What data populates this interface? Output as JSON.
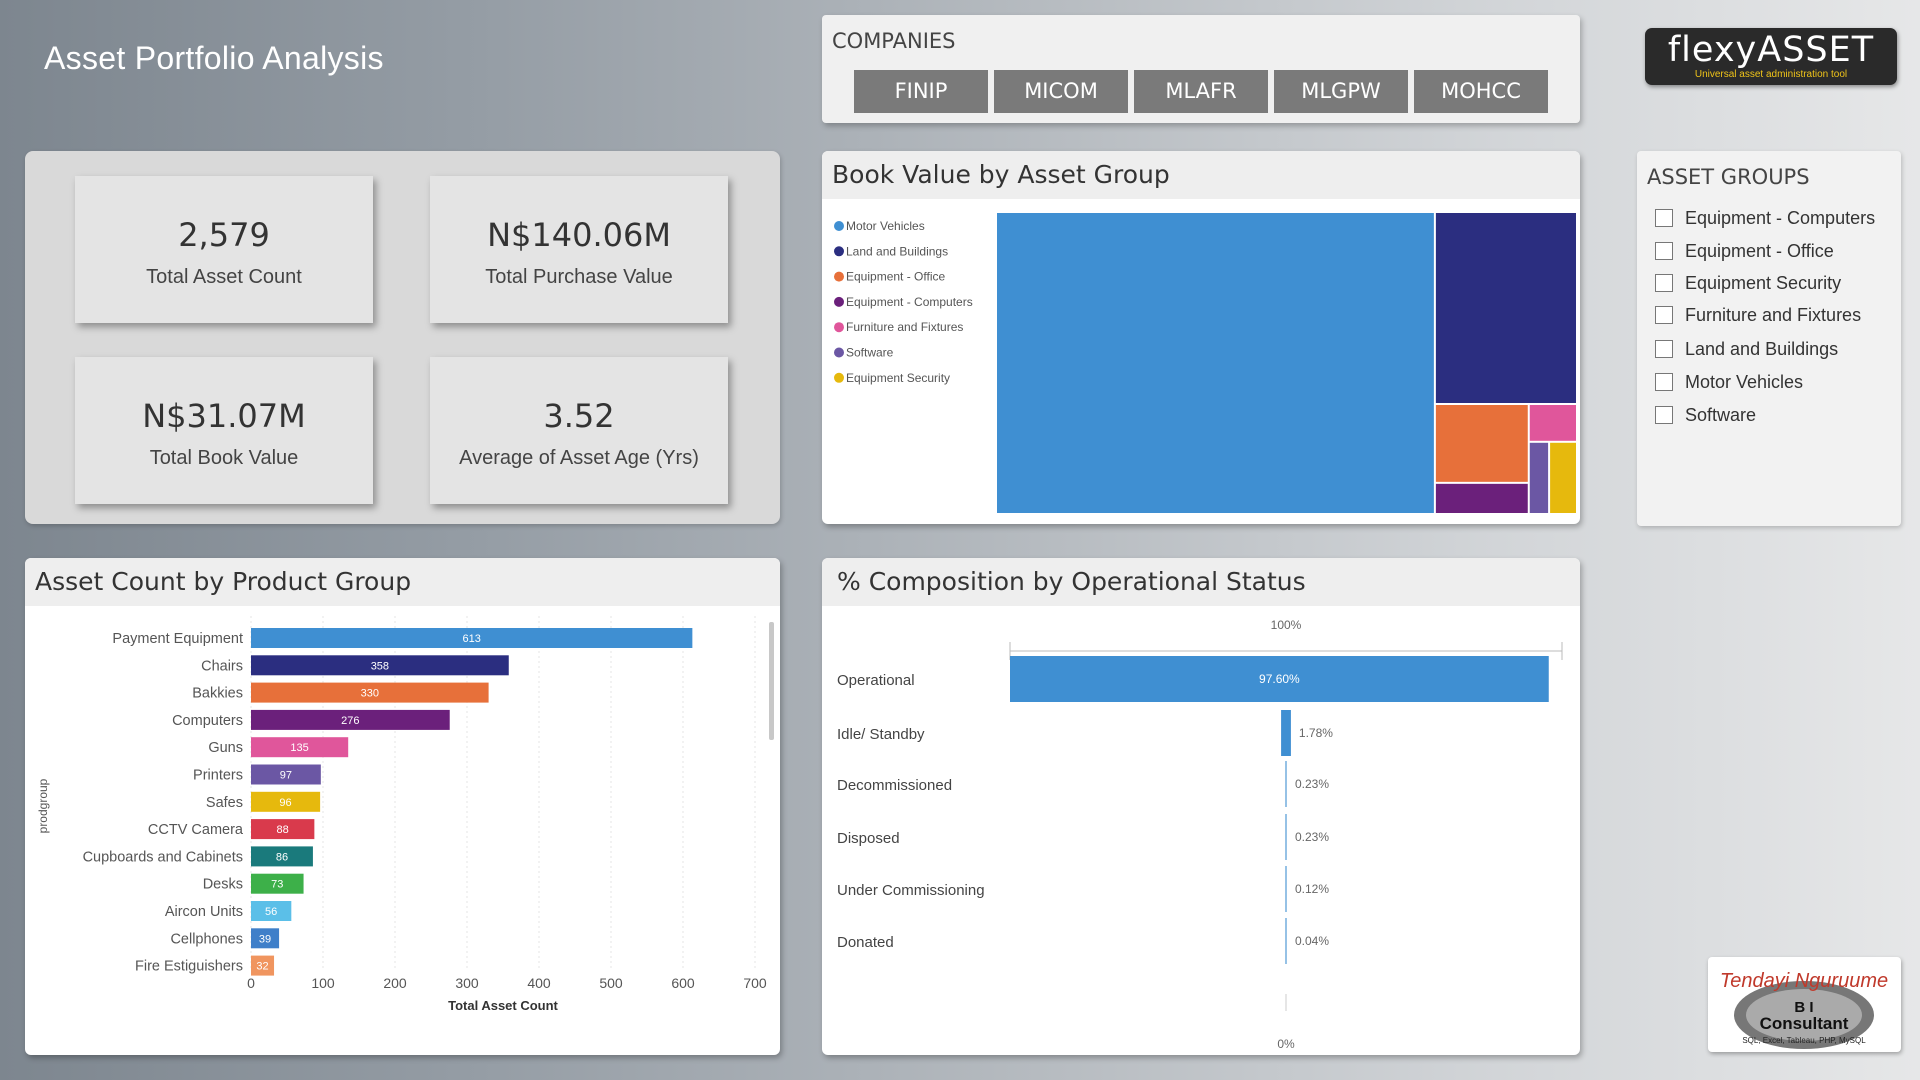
{
  "page": {
    "title": "Asset Portfolio Analysis"
  },
  "companies": {
    "label": "COMPANIES",
    "items": [
      "FINIP",
      "MICOM",
      "MLAFR",
      "MLGPW",
      "MOHCC"
    ]
  },
  "logo": {
    "text_main": "flexy",
    "text_accent": "ASSET",
    "tagline": "Universal asset administration tool"
  },
  "kpis": [
    {
      "value": "2,579",
      "label": "Total Asset Count"
    },
    {
      "value": "N$140.06M",
      "label": "Total Purchase Value"
    },
    {
      "value": "N$31.07M",
      "label": "Total Book Value"
    },
    {
      "value": "3.52",
      "label": "Average of Asset Age (Yrs)"
    }
  ],
  "asset_groups": {
    "label": "ASSET GROUPS",
    "items": [
      "Equipment - Computers",
      "Equipment - Office",
      "Equipment Security",
      "Furniture and Fixtures",
      "Land and Buildings",
      "Motor Vehicles",
      "Software"
    ]
  },
  "consultant": {
    "line1": "Tendayi Nguruume",
    "line2": "B I",
    "line3": "Consultant",
    "line4": "SQL, Excel, Tableau, PHP, MySQL"
  },
  "chart_data": [
    {
      "type": "treemap",
      "title": "Book Value by Asset Group",
      "legend": [
        {
          "name": "Motor Vehicles",
          "color": "#3f8fd2"
        },
        {
          "name": "Land and Buildings",
          "color": "#2b2e80"
        },
        {
          "name": "Equipment - Office",
          "color": "#e7703a"
        },
        {
          "name": "Equipment - Computers",
          "color": "#6b207b"
        },
        {
          "name": "Furniture and Fixtures",
          "color": "#e0569b"
        },
        {
          "name": "Software",
          "color": "#6b57a4"
        },
        {
          "name": "Equipment Security",
          "color": "#e6b90d"
        }
      ],
      "values_share": [
        0.76,
        0.16,
        0.04,
        0.015,
        0.015,
        0.007,
        0.01
      ],
      "legend_position": "left"
    },
    {
      "type": "bar",
      "orientation": "horizontal",
      "title": "Asset Count by Product Group",
      "xlabel": "Total Asset Count",
      "ylabel": "prodgroup",
      "xlim": [
        0,
        700
      ],
      "xticks": [
        0,
        100,
        200,
        300,
        400,
        500,
        600,
        700
      ],
      "categories": [
        "Payment Equipment",
        "Chairs",
        "Bakkies",
        "Computers",
        "Guns",
        "Printers",
        "Safes",
        "CCTV Camera",
        "Cupboards and Cabinets",
        "Desks",
        "Aircon Units",
        "Cellphones",
        "Fire Estiguishers"
      ],
      "values": [
        613,
        358,
        330,
        276,
        135,
        97,
        96,
        88,
        86,
        73,
        56,
        39,
        32
      ],
      "colors": [
        "#3f8fd2",
        "#2b2e80",
        "#e7703a",
        "#6b207b",
        "#e0569b",
        "#6b57a4",
        "#e6b90d",
        "#d93a4c",
        "#1a7a7c",
        "#3db049",
        "#5bbfe8",
        "#3f7fc9",
        "#f0955f"
      ]
    },
    {
      "type": "bar",
      "orientation": "horizontal",
      "title": "% Composition by Operational Status",
      "top_label": "100%",
      "bottom_label": "0%",
      "categories": [
        "Operational",
        "Idle/ Standby",
        "Decommissioned",
        "Disposed",
        "Under Commissioning",
        "Donated"
      ],
      "values": [
        97.6,
        1.78,
        0.23,
        0.23,
        0.12,
        0.04
      ],
      "value_labels": [
        "97.60%",
        "1.78%",
        "0.23%",
        "0.23%",
        "0.12%",
        "0.04%"
      ],
      "color": "#3f8fd2"
    }
  ]
}
